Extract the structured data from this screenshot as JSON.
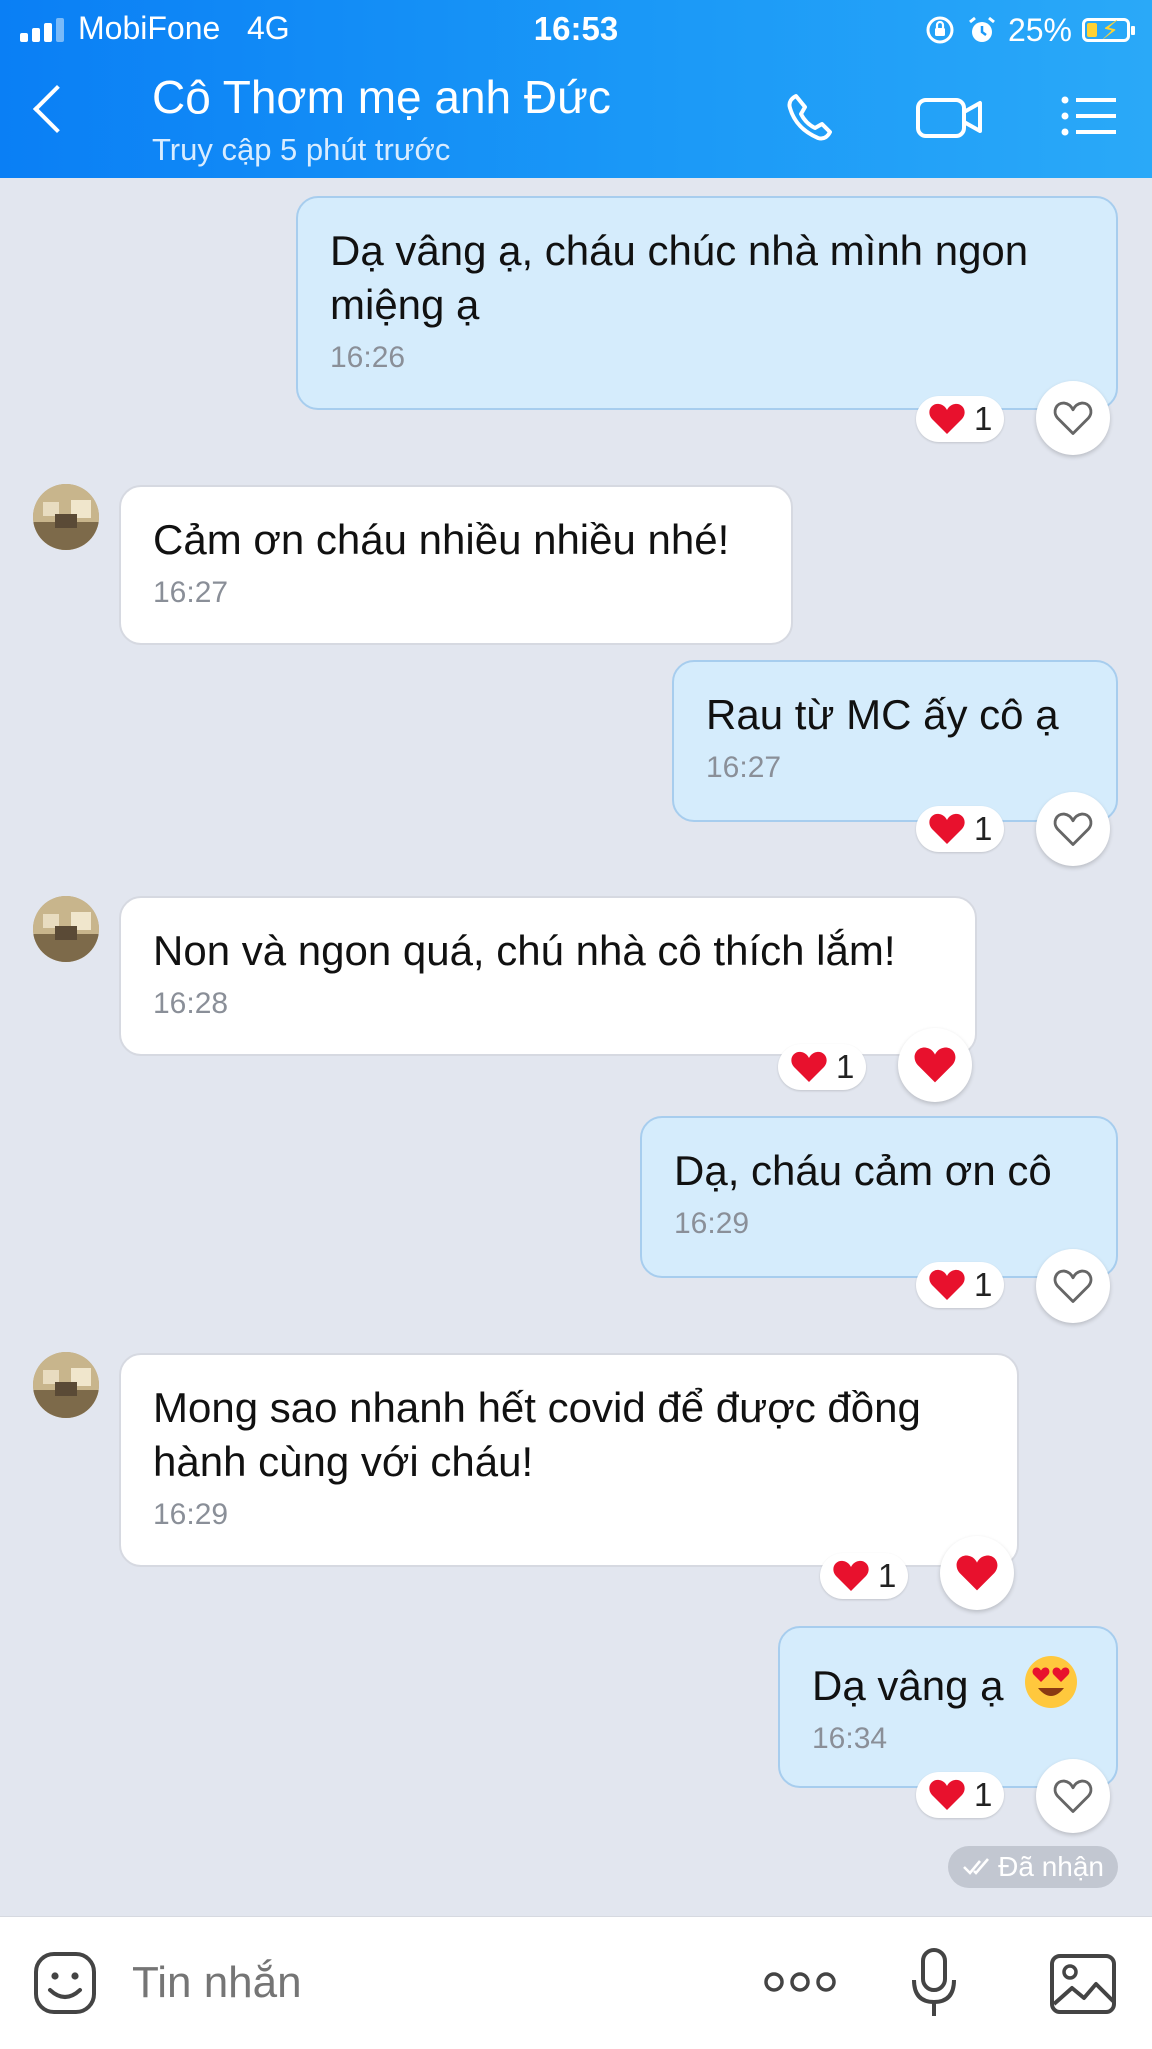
{
  "status_bar": {
    "carrier": "MobiFone",
    "network": "4G",
    "time": "16:53",
    "battery": "25%"
  },
  "header": {
    "title": "Cô Thơm mẹ anh Đức",
    "subtitle": "Truy cập 5 phút trước",
    "icons": [
      "back-icon",
      "phone-icon",
      "video-call-icon",
      "menu-icon"
    ]
  },
  "messages": [
    {
      "direction": "out",
      "text": "Dạ vâng ạ, cháu chúc nhà mình ngon miệng ạ",
      "time": "16:26",
      "reaction": {
        "emoji": "heart",
        "count": "1"
      },
      "react_button": "heart-outline-icon"
    },
    {
      "direction": "in",
      "text": "Cảm ơn cháu nhiều nhiều nhé!",
      "time": "16:27"
    },
    {
      "direction": "out",
      "text": "Rau từ MC ấy cô ạ",
      "time": "16:27",
      "reaction": {
        "emoji": "heart",
        "count": "1"
      },
      "react_button": "heart-outline-icon"
    },
    {
      "direction": "in",
      "text": "Non và ngon quá, chú nhà cô thích lắm!",
      "time": "16:28",
      "reaction": {
        "emoji": "heart",
        "count": "1"
      },
      "react_button": "heart-filled-icon"
    },
    {
      "direction": "out",
      "text": "Dạ, cháu cảm ơn cô",
      "time": "16:29",
      "reaction": {
        "emoji": "heart",
        "count": "1"
      },
      "react_button": "heart-outline-icon"
    },
    {
      "direction": "in",
      "text": "Mong sao nhanh hết covid để được đồng hành cùng với cháu!",
      "time": "16:29",
      "reaction": {
        "emoji": "heart",
        "count": "1"
      },
      "react_button": "heart-filled-icon"
    },
    {
      "direction": "out",
      "text": "Dạ vâng ạ",
      "emoji": "heart-eyes-emoji",
      "time": "16:34",
      "reaction": {
        "emoji": "heart",
        "count": "1"
      },
      "react_button": "heart-outline-icon"
    }
  ],
  "receipt": "Đã nhận",
  "composer": {
    "placeholder": "Tin nhắn",
    "icons": [
      "sticker-icon",
      "more-icon",
      "microphone-icon",
      "image-icon"
    ]
  },
  "colors": {
    "header_blue": "#1a98f7",
    "outgoing_bubble": "#d5ecfc",
    "incoming_bubble": "#ffffff",
    "chat_background": "#e2e6ef",
    "heart_red": "#e8112d"
  }
}
